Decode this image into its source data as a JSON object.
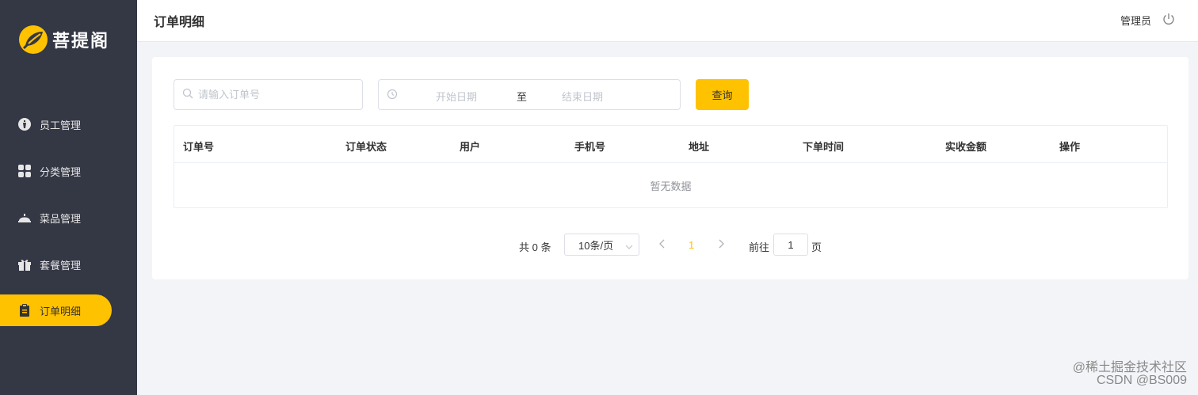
{
  "app": {
    "brand": "菩提阁"
  },
  "sidebar": {
    "items": [
      {
        "label": "员工管理",
        "icon": "employee-icon",
        "active": false
      },
      {
        "label": "分类管理",
        "icon": "category-grid-icon",
        "active": false
      },
      {
        "label": "菜品管理",
        "icon": "dish-cloche-icon",
        "active": false
      },
      {
        "label": "套餐管理",
        "icon": "gift-package-icon",
        "active": false
      },
      {
        "label": "订单明细",
        "icon": "clipboard-icon",
        "active": true
      }
    ]
  },
  "header": {
    "title": "订单明细",
    "user": "管理员",
    "logout_icon": "power-icon"
  },
  "filters": {
    "order_placeholder": "请输入订单号",
    "start_placeholder": "开始日期",
    "range_separator": "至",
    "end_placeholder": "结束日期",
    "query_label": "查询"
  },
  "table": {
    "columns": [
      "订单号",
      "订单状态",
      "用户",
      "手机号",
      "地址",
      "下单时间",
      "实收金额",
      "操作"
    ],
    "rows": [],
    "empty_text": "暂无数据"
  },
  "pagination": {
    "total_text": "共 0 条",
    "page_size": "10条/页",
    "current_page": "1",
    "goto_label": "前往",
    "goto_value": "1",
    "page_suffix": "页"
  },
  "watermark": {
    "line1": "@稀土掘金技术社区",
    "line2": "CSDN @BS009"
  },
  "colors": {
    "sidebar_bg": "#343744",
    "accent": "#ffc200",
    "page_bg": "#f3f4f7"
  }
}
